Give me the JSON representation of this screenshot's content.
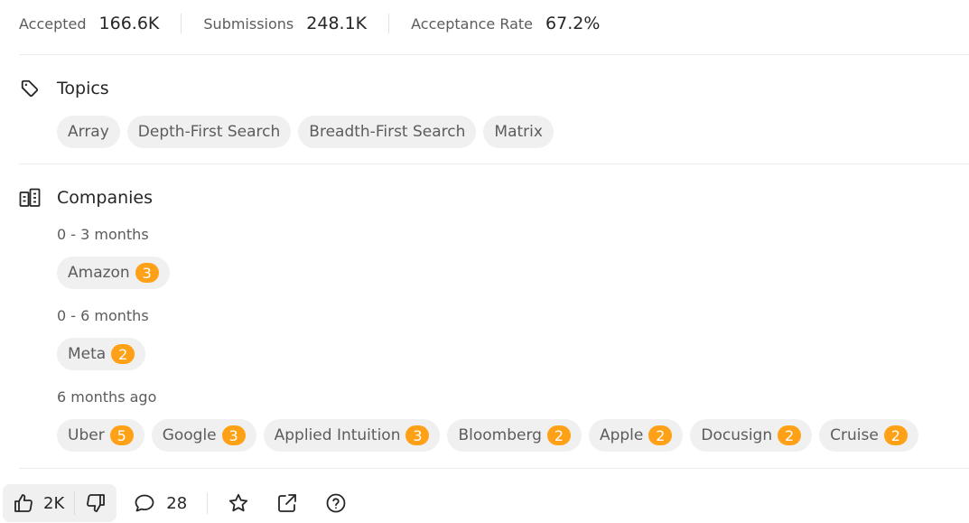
{
  "stats": [
    {
      "label": "Accepted",
      "value": "166.6K"
    },
    {
      "label": "Submissions",
      "value": "248.1K"
    },
    {
      "label": "Acceptance Rate",
      "value": "67.2%"
    }
  ],
  "topics": {
    "title": "Topics",
    "icon": "tag-icon",
    "items": [
      "Array",
      "Depth-First Search",
      "Breadth-First Search",
      "Matrix"
    ]
  },
  "companies": {
    "title": "Companies",
    "icon": "building-icon",
    "groups": [
      {
        "period": "0 - 3 months",
        "items": [
          {
            "name": "Amazon",
            "count": "3"
          }
        ]
      },
      {
        "period": "0 - 6 months",
        "items": [
          {
            "name": "Meta",
            "count": "2"
          }
        ]
      },
      {
        "period": "6 months ago",
        "items": [
          {
            "name": "Uber",
            "count": "5"
          },
          {
            "name": "Google",
            "count": "3"
          },
          {
            "name": "Applied Intuition",
            "count": "3"
          },
          {
            "name": "Bloomberg",
            "count": "2"
          },
          {
            "name": "Apple",
            "count": "2"
          },
          {
            "name": "Docusign",
            "count": "2"
          },
          {
            "name": "Cruise",
            "count": "2"
          }
        ]
      }
    ]
  },
  "actions": {
    "likes": "2K",
    "comments": "28",
    "icons": [
      "thumbs-up-icon",
      "thumbs-down-icon",
      "comment-icon",
      "star-icon",
      "share-icon",
      "help-icon"
    ]
  },
  "colors": {
    "badge": "#ffa116",
    "tag_bg": "#f0f0f0",
    "text_primary": "#262626",
    "text_secondary": "#5c5c5c"
  }
}
